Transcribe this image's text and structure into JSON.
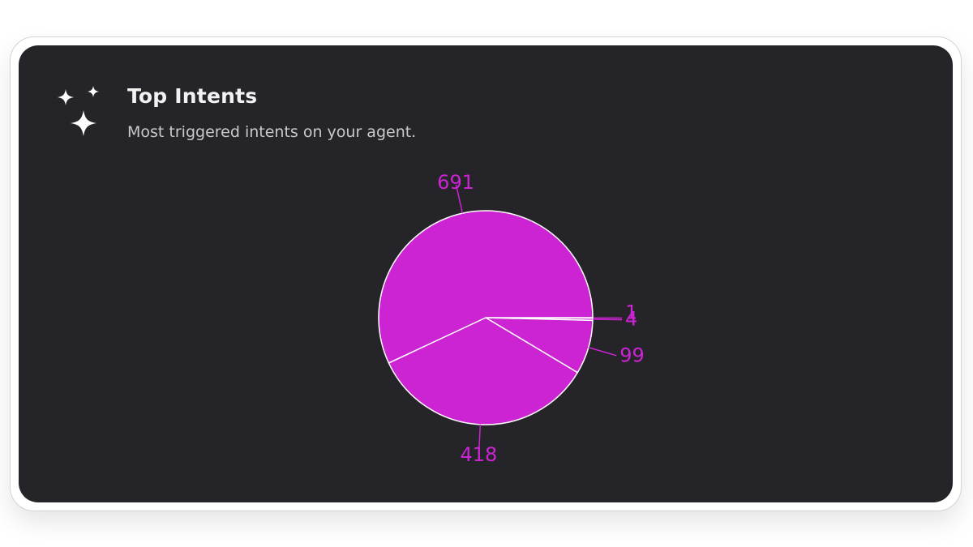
{
  "card": {
    "title": "Top Intents",
    "subtitle": "Most triggered intents on your agent.",
    "icon": "sparkles-icon"
  },
  "colors": {
    "background": "#252429",
    "slice": "#cc23d3",
    "slice_border": "#ffffff",
    "title": "#f2f2f2",
    "subtitle": "#c9c9cc"
  },
  "chart_data": {
    "type": "pie",
    "title": "",
    "slices": [
      {
        "value": 1
      },
      {
        "value": 4
      },
      {
        "value": 99
      },
      {
        "value": 418
      },
      {
        "value": 691
      }
    ],
    "start_direction": "east",
    "direction": "clockwise",
    "labels": "value labels with leader lines outside slices",
    "legend": "none"
  }
}
